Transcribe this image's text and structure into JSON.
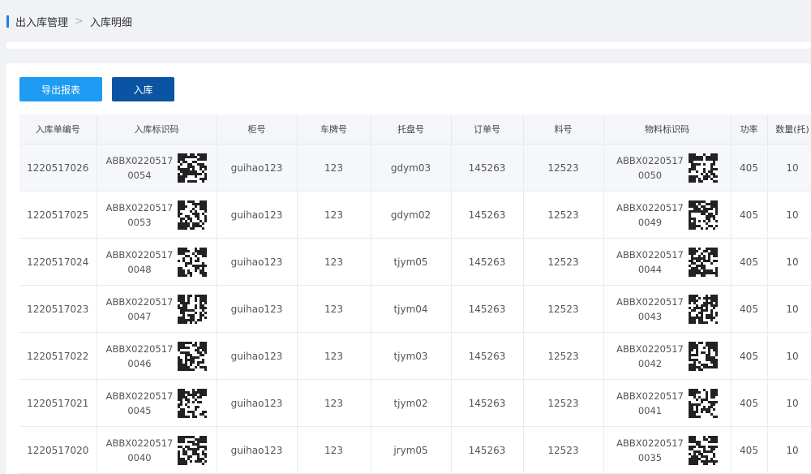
{
  "breadcrumb": {
    "parent": "出入库管理",
    "separator": ">",
    "current": "入库明细"
  },
  "toolbar": {
    "export_label": "导出报表",
    "inbound_label": "入库"
  },
  "table": {
    "headers": [
      "入库单编号",
      "入库标识码",
      "柜号",
      "车牌号",
      "托盘号",
      "订单号",
      "料号",
      "物料标识码",
      "功率",
      "数量(托)"
    ],
    "rows": [
      {
        "id": "1220517026",
        "code1": "ABBX0220517",
        "code2": "0054",
        "cabinet": "guihao123",
        "plate": "123",
        "tray": "gdym03",
        "order": "145263",
        "part": "12523",
        "mcode1": "ABBX0220517",
        "mcode2": "0050",
        "power": "405",
        "qty": "10"
      },
      {
        "id": "1220517025",
        "code1": "ABBX0220517",
        "code2": "0053",
        "cabinet": "guihao123",
        "plate": "123",
        "tray": "gdym02",
        "order": "145263",
        "part": "12523",
        "mcode1": "ABBX0220517",
        "mcode2": "0049",
        "power": "405",
        "qty": "10"
      },
      {
        "id": "1220517024",
        "code1": "ABBX0220517",
        "code2": "0048",
        "cabinet": "guihao123",
        "plate": "123",
        "tray": "tjym05",
        "order": "145263",
        "part": "12523",
        "mcode1": "ABBX0220517",
        "mcode2": "0044",
        "power": "405",
        "qty": "10"
      },
      {
        "id": "1220517023",
        "code1": "ABBX0220517",
        "code2": "0047",
        "cabinet": "guihao123",
        "plate": "123",
        "tray": "tjym04",
        "order": "145263",
        "part": "12523",
        "mcode1": "ABBX0220517",
        "mcode2": "0043",
        "power": "405",
        "qty": "10"
      },
      {
        "id": "1220517022",
        "code1": "ABBX0220517",
        "code2": "0046",
        "cabinet": "guihao123",
        "plate": "123",
        "tray": "tjym03",
        "order": "145263",
        "part": "12523",
        "mcode1": "ABBX0220517",
        "mcode2": "0042",
        "power": "405",
        "qty": "10"
      },
      {
        "id": "1220517021",
        "code1": "ABBX0220517",
        "code2": "0045",
        "cabinet": "guihao123",
        "plate": "123",
        "tray": "tjym02",
        "order": "145263",
        "part": "12523",
        "mcode1": "ABBX0220517",
        "mcode2": "0041",
        "power": "405",
        "qty": "10"
      },
      {
        "id": "1220517020",
        "code1": "ABBX0220517",
        "code2": "0040",
        "cabinet": "guihao123",
        "plate": "123",
        "tray": "jrym05",
        "order": "145263",
        "part": "12523",
        "mcode1": "ABBX0220517",
        "mcode2": "0035",
        "power": "405",
        "qty": "10"
      }
    ]
  },
  "colors": {
    "accent": "#1683e6",
    "export_button": "#1e9bf3",
    "inbound_button": "#0a54a3"
  },
  "icons": {
    "qr": "qr-code-icon"
  }
}
